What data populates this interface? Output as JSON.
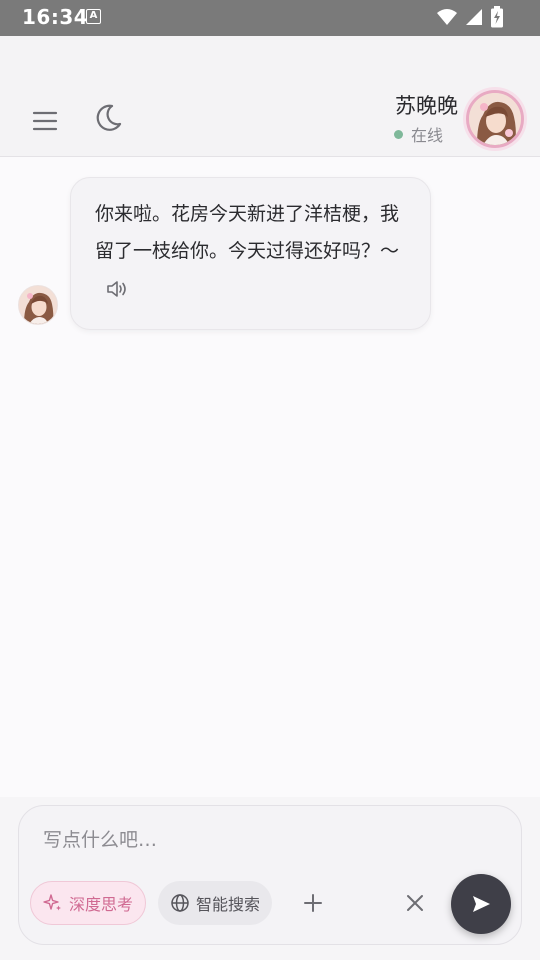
{
  "status_bar": {
    "time": "16:34",
    "notification_icon": "A"
  },
  "header": {
    "contact_name": "苏晚晚",
    "contact_status": "在线",
    "online_color": "#7fb89a"
  },
  "messages": [
    {
      "sender": "苏晚晚",
      "text": "你来啦。花房今天新进了洋桔梗，我留了一枝给你。今天过得还好吗？～",
      "has_voice_icon": true
    }
  ],
  "composer": {
    "placeholder": "写点什么吧…",
    "value": "",
    "deep_think_label": "深度思考",
    "web_search_label": "智能搜索",
    "accent_color": "#d06a92",
    "send_button_color": "#3f3f48"
  },
  "icons": {
    "menu": "menu-icon",
    "theme": "moon-icon",
    "voice": "speaker-icon",
    "deep_think": "sparkle-icon",
    "web_search": "globe-icon",
    "add": "plus-icon",
    "clear": "close-icon",
    "send": "send-icon"
  }
}
